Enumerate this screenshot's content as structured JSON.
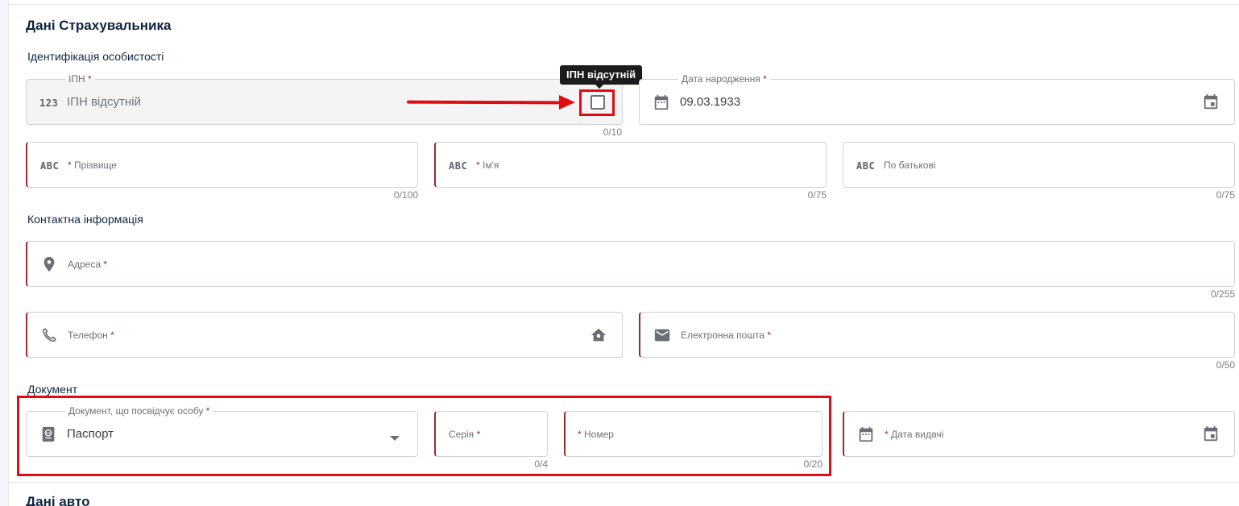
{
  "insurer": {
    "title": "Дані Страхувальника",
    "identification": {
      "group_title": "Ідентифікація особистості",
      "ipn": {
        "legend": "ІПН",
        "value": "ІПН відсутній",
        "counter": "0/10",
        "icon": "123"
      },
      "ipn_missing": {
        "tooltip": "ІПН відсутній"
      },
      "birth_date": {
        "legend": "Дата народження",
        "value": "09.03.1933"
      },
      "surname": {
        "placeholder": "Прізвище",
        "counter": "0/100",
        "icon": "ABC"
      },
      "name": {
        "placeholder": "Ім'я",
        "counter": "0/75",
        "icon": "ABC"
      },
      "patronymic": {
        "placeholder": "По батькові",
        "counter": "0/75",
        "icon": "ABC"
      }
    },
    "contacts": {
      "group_title": "Контактна інформація",
      "address": {
        "placeholder": "Адреса",
        "counter": "0/255"
      },
      "phone": {
        "placeholder": "Телефон"
      },
      "email": {
        "placeholder": "Електронна пошта",
        "counter": "0/50"
      }
    },
    "document": {
      "group_title": "Документ",
      "doc_type": {
        "legend": "Документ, що посвідчує особу",
        "value": "Паспорт"
      },
      "series": {
        "placeholder": "Серія",
        "counter": "0/4"
      },
      "number": {
        "placeholder": "Номер",
        "counter": "0/20"
      },
      "issue_date": {
        "placeholder": "Дата видачі"
      }
    },
    "required_mark": "*"
  },
  "car": {
    "title": "Дані авто"
  },
  "colors": {
    "accent": "#0f2540",
    "required": "#9b2a2f",
    "annotation": "#e00c12"
  }
}
